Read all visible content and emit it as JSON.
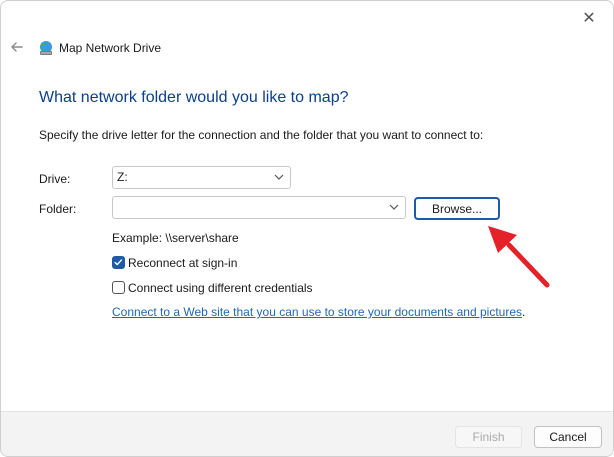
{
  "window": {
    "title": "Map Network Drive",
    "close_glyph": "✕",
    "back_glyph": "←"
  },
  "content": {
    "heading": "What network folder would you like to map?",
    "instruction": "Specify the drive letter for the connection and the folder that you want to connect to:",
    "drive": {
      "label": "Drive:",
      "value": "Z:"
    },
    "folder": {
      "label": "Folder:",
      "value": ""
    },
    "browse_label": "Browse...",
    "example": "Example: \\\\server\\share",
    "reconnect": {
      "label": "Reconnect at sign-in",
      "checked": true
    },
    "different_credentials": {
      "label": "Connect using different credentials",
      "checked": false
    },
    "web_link": "Connect to a Web site that you can use to store your documents and pictures",
    "web_link_suffix": "."
  },
  "footer": {
    "finish_label": "Finish",
    "cancel_label": "Cancel"
  },
  "colors": {
    "heading": "#0b3f8a",
    "link": "#1e68b6",
    "accent": "#1e5aa8",
    "annotation_arrow": "#e5222a"
  },
  "icons": {
    "window_icon": "network-drive-globe-icon",
    "chevron": "chevron-down-icon",
    "check": "checkmark-icon",
    "arrow": "annotation-arrow-icon"
  }
}
